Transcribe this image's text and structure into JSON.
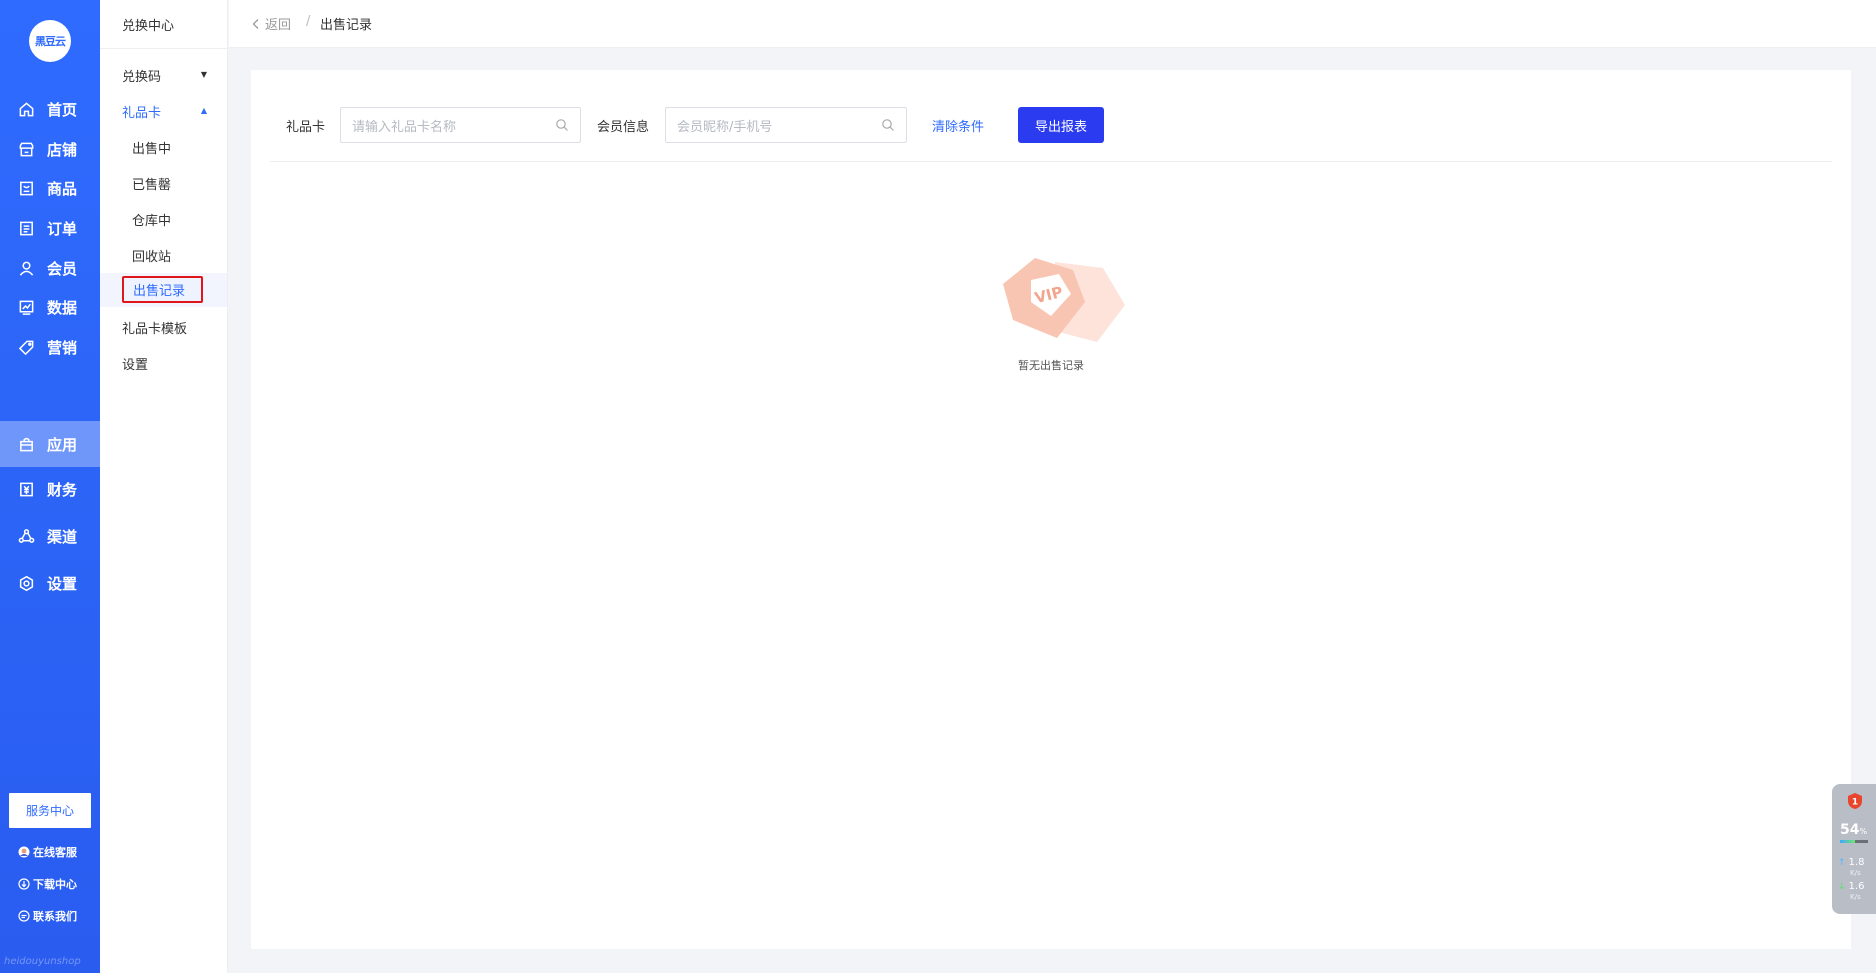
{
  "brand": {
    "logo_text": "黑豆云"
  },
  "main_nav": {
    "items": [
      {
        "label": "首页",
        "icon": "home-icon"
      },
      {
        "label": "店铺",
        "icon": "store-icon"
      },
      {
        "label": "商品",
        "icon": "goods-icon"
      },
      {
        "label": "订单",
        "icon": "order-icon"
      },
      {
        "label": "会员",
        "icon": "member-icon"
      },
      {
        "label": "数据",
        "icon": "chart-icon"
      },
      {
        "label": "营销",
        "icon": "tag-icon"
      },
      {
        "label": "应用",
        "icon": "app-icon",
        "active": true
      },
      {
        "label": "财务",
        "icon": "finance-icon"
      },
      {
        "label": "渠道",
        "icon": "channel-icon"
      },
      {
        "label": "设置",
        "icon": "settings-icon"
      }
    ],
    "service_button": "服务中心",
    "footer_links": [
      {
        "label": "在线客服",
        "icon": "customer-service-icon"
      },
      {
        "label": "下载中心",
        "icon": "download-icon"
      },
      {
        "label": "联系我们",
        "icon": "chat-icon"
      }
    ],
    "watermark": "heidouyunshop"
  },
  "sub_nav": {
    "title": "兑换中心",
    "groups": {
      "code": {
        "label": "兑换码",
        "caret": "▼"
      },
      "giftcard": {
        "label": "礼品卡",
        "caret": "▲"
      }
    },
    "giftcard_items": [
      "出售中",
      "已售罄",
      "仓库中",
      "回收站",
      "出售记录"
    ],
    "template": "礼品卡模板",
    "settings": "设置"
  },
  "breadcrumb": {
    "back": "返回",
    "separator": "/",
    "current": "出售记录"
  },
  "filters": {
    "giftcard_label": "礼品卡",
    "giftcard_placeholder": "请输入礼品卡名称",
    "member_label": "会员信息",
    "member_placeholder": "会员昵称/手机号",
    "clear": "清除条件",
    "export": "导出报表"
  },
  "empty_state": {
    "badge": "VIP",
    "text": "暂无出售记录"
  },
  "system_widget": {
    "badge": "1",
    "percent": "54",
    "percent_unit": "%",
    "cpu_fraction": 0.54,
    "up_speed": "1.8",
    "down_speed": "1.6",
    "speed_unit": "K/s"
  },
  "colors": {
    "primary": "#2f6bff",
    "export_button": "#2b3cf0",
    "highlight_border": "#e0161a",
    "empty_ill": "#f7b9a5"
  }
}
